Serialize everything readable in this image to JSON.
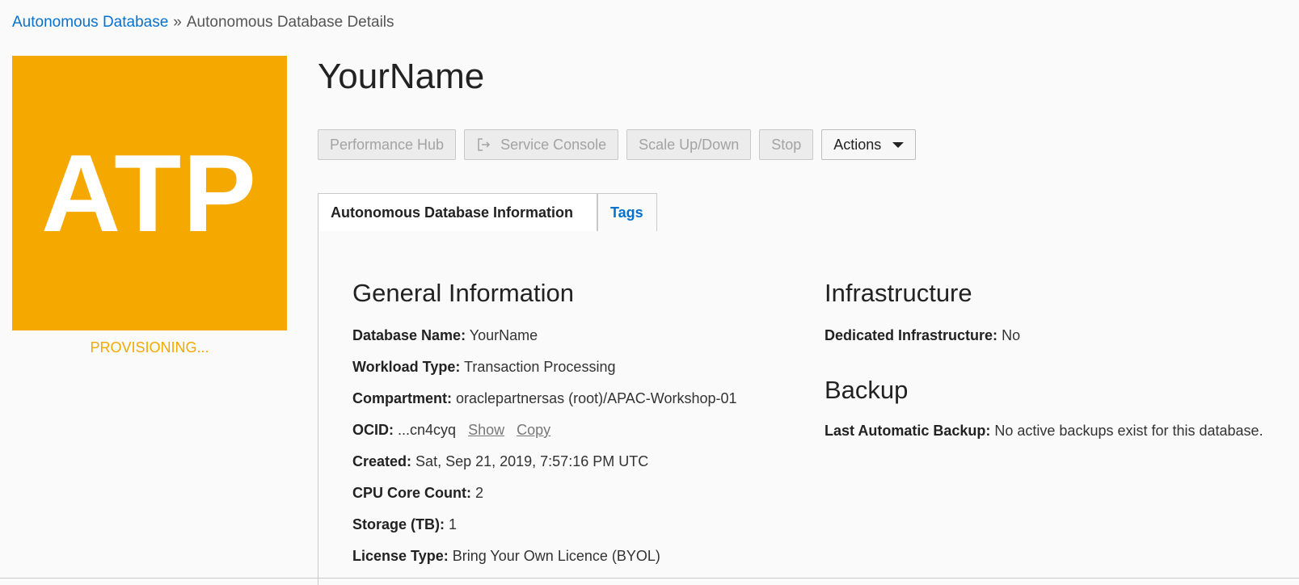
{
  "breadcrumb": {
    "link": "Autonomous Database",
    "separator": "»",
    "current": "Autonomous Database Details"
  },
  "tile": {
    "text": "ATP",
    "color": "#f5a800",
    "state": "PROVISIONING..."
  },
  "title": "YourName",
  "toolbar": {
    "performance_hub": "Performance Hub",
    "service_console": "Service Console",
    "scale": "Scale Up/Down",
    "stop": "Stop",
    "actions": "Actions"
  },
  "tabs": {
    "info": "Autonomous Database Information",
    "tags": "Tags"
  },
  "general": {
    "heading": "General Information",
    "db_name_label": "Database Name:",
    "db_name": "YourName",
    "workload_label": "Workload Type:",
    "workload": "Transaction Processing",
    "compartment_label": "Compartment:",
    "compartment": "oraclepartnersas (root)/APAC-Workshop-01",
    "ocid_label": "OCID:",
    "ocid": "...cn4cyq",
    "ocid_show": "Show",
    "ocid_copy": "Copy",
    "created_label": "Created:",
    "created": "Sat, Sep 21, 2019, 7:57:16 PM UTC",
    "cpu_label": "CPU Core Count:",
    "cpu": "2",
    "storage_label": "Storage (TB):",
    "storage": "1",
    "license_label": "License Type:",
    "license": "Bring Your Own Licence (BYOL)"
  },
  "infrastructure": {
    "heading": "Infrastructure",
    "dedicated_label": "Dedicated Infrastructure:",
    "dedicated": "No"
  },
  "backup": {
    "heading": "Backup",
    "last_label": "Last Automatic Backup:",
    "last": "No active backups exist for this database."
  },
  "colors": {
    "link": "#0572ce",
    "accent": "#f5a800"
  }
}
